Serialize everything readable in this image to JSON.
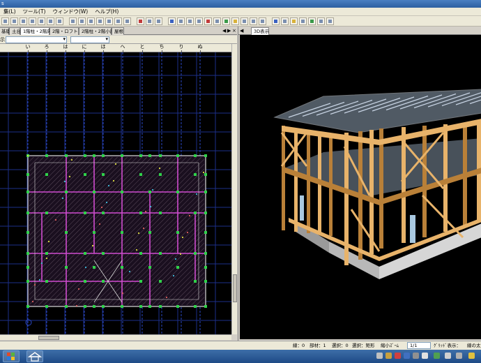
{
  "titlebar": {
    "title": "s"
  },
  "menu": [
    "集(L)",
    "ツール(T)",
    "ウィンドウ(W)",
    "ヘルプ(H)"
  ],
  "left_tabs": [
    {
      "label": "基礎",
      "active": false
    },
    {
      "label": "土台",
      "active": false
    },
    {
      "label": "1階柱・2階床",
      "active": true
    },
    {
      "label": "2階・ロフト",
      "active": false
    },
    {
      "label": "2階柱・2階小屋",
      "active": false
    },
    {
      "label": "屋根",
      "active": false
    }
  ],
  "tab_controls": {
    "prev": "◀",
    "next": "▶",
    "close": "×"
  },
  "layer_label": "示",
  "grid_axes": [
    "い",
    "ろ",
    "は",
    "に",
    "ほ",
    "へ",
    "と",
    "ち",
    "り",
    "ぬ"
  ],
  "right_tab": {
    "label": "3D表示",
    "control": "◀"
  },
  "status": {
    "item1": "線：0",
    "item2": "部材：1",
    "item3": "選択：0",
    "item4": "選択：矩形",
    "item5": "縮小ｽﾞｰﾑ",
    "ratio": "1/1",
    "item6": "ｸﾞﾘｯﾄﾞ表示：",
    "item7": "線の太"
  },
  "colors": {
    "grid_blue": "#1d2f8a",
    "grid_bright": "#2a48c4",
    "wall_magenta": "#d04cd0",
    "post_green": "#2fd24a",
    "cad_white": "#dcdcdc",
    "timber": "#e8b36a",
    "timber_dark": "#b98038",
    "foundation": "#b8b8b8",
    "glass": "#9fb4c8"
  }
}
